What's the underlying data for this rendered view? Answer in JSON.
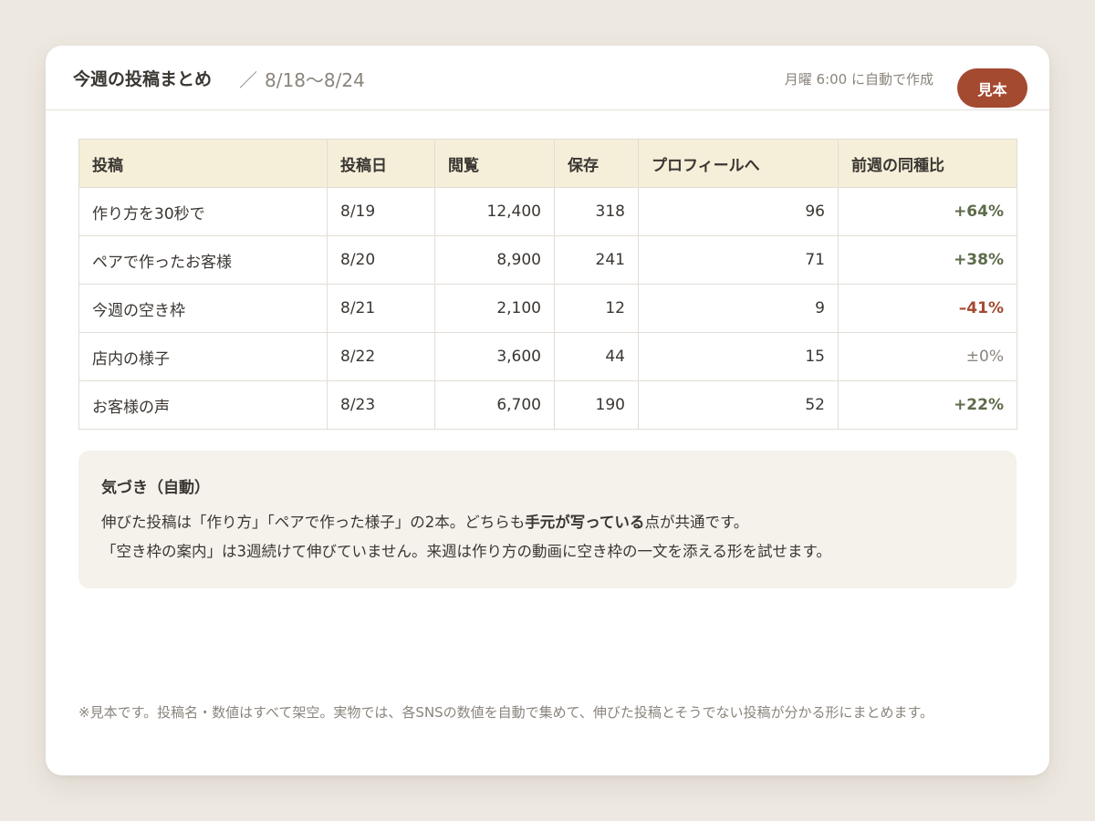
{
  "header": {
    "title": "今週の投稿まとめ",
    "separator": "／",
    "date_range": "8/18〜8/24",
    "auto_note": "月曜 6:00 に自動で作成",
    "badge": "見本"
  },
  "table": {
    "columns": [
      "投稿",
      "投稿日",
      "閲覧",
      "保存",
      "プロフィールへ",
      "前週の同種比"
    ],
    "rows": [
      {
        "post": "作り方を30秒で",
        "date": "8/19",
        "views": "12,400",
        "saves": "318",
        "profile": "96",
        "change": "+64%"
      },
      {
        "post": "ペアで作ったお客様",
        "date": "8/20",
        "views": "8,900",
        "saves": "241",
        "profile": "71",
        "change": "+38%"
      },
      {
        "post": "今週の空き枠",
        "date": "8/21",
        "views": "2,100",
        "saves": "12",
        "profile": "9",
        "change": "–41%"
      },
      {
        "post": "店内の様子",
        "date": "8/22",
        "views": "3,600",
        "saves": "44",
        "profile": "15",
        "change": "±0%"
      },
      {
        "post": "お客様の声",
        "date": "8/23",
        "views": "6,700",
        "saves": "190",
        "profile": "52",
        "change": "+22%"
      }
    ]
  },
  "insight": {
    "title": "気づき（自動）",
    "line1_before": "伸びた投稿は「作り方」「ペアで作った様子」の2本。どちらも",
    "line1_bold": "手元が写っている",
    "line1_after": "点が共通です。",
    "line2": "「空き枠の案内」は3週続けて伸びていません。来週は作り方の動画に空き枠の一文を添える形を試せます。"
  },
  "footnote": "※見本です。投稿名・数値はすべて架空。実物では、各SNSの数値を自動で集めて、伸びた投稿とそうでない投稿が分かる形にまとめます。",
  "colors": {
    "accent": "#a44a30",
    "positive": "#5d6b4b",
    "neutral": "#8a847c",
    "header_bg": "#f5efd9",
    "insight_bg": "#f5f2ec",
    "page_bg": "#ede8e1"
  }
}
